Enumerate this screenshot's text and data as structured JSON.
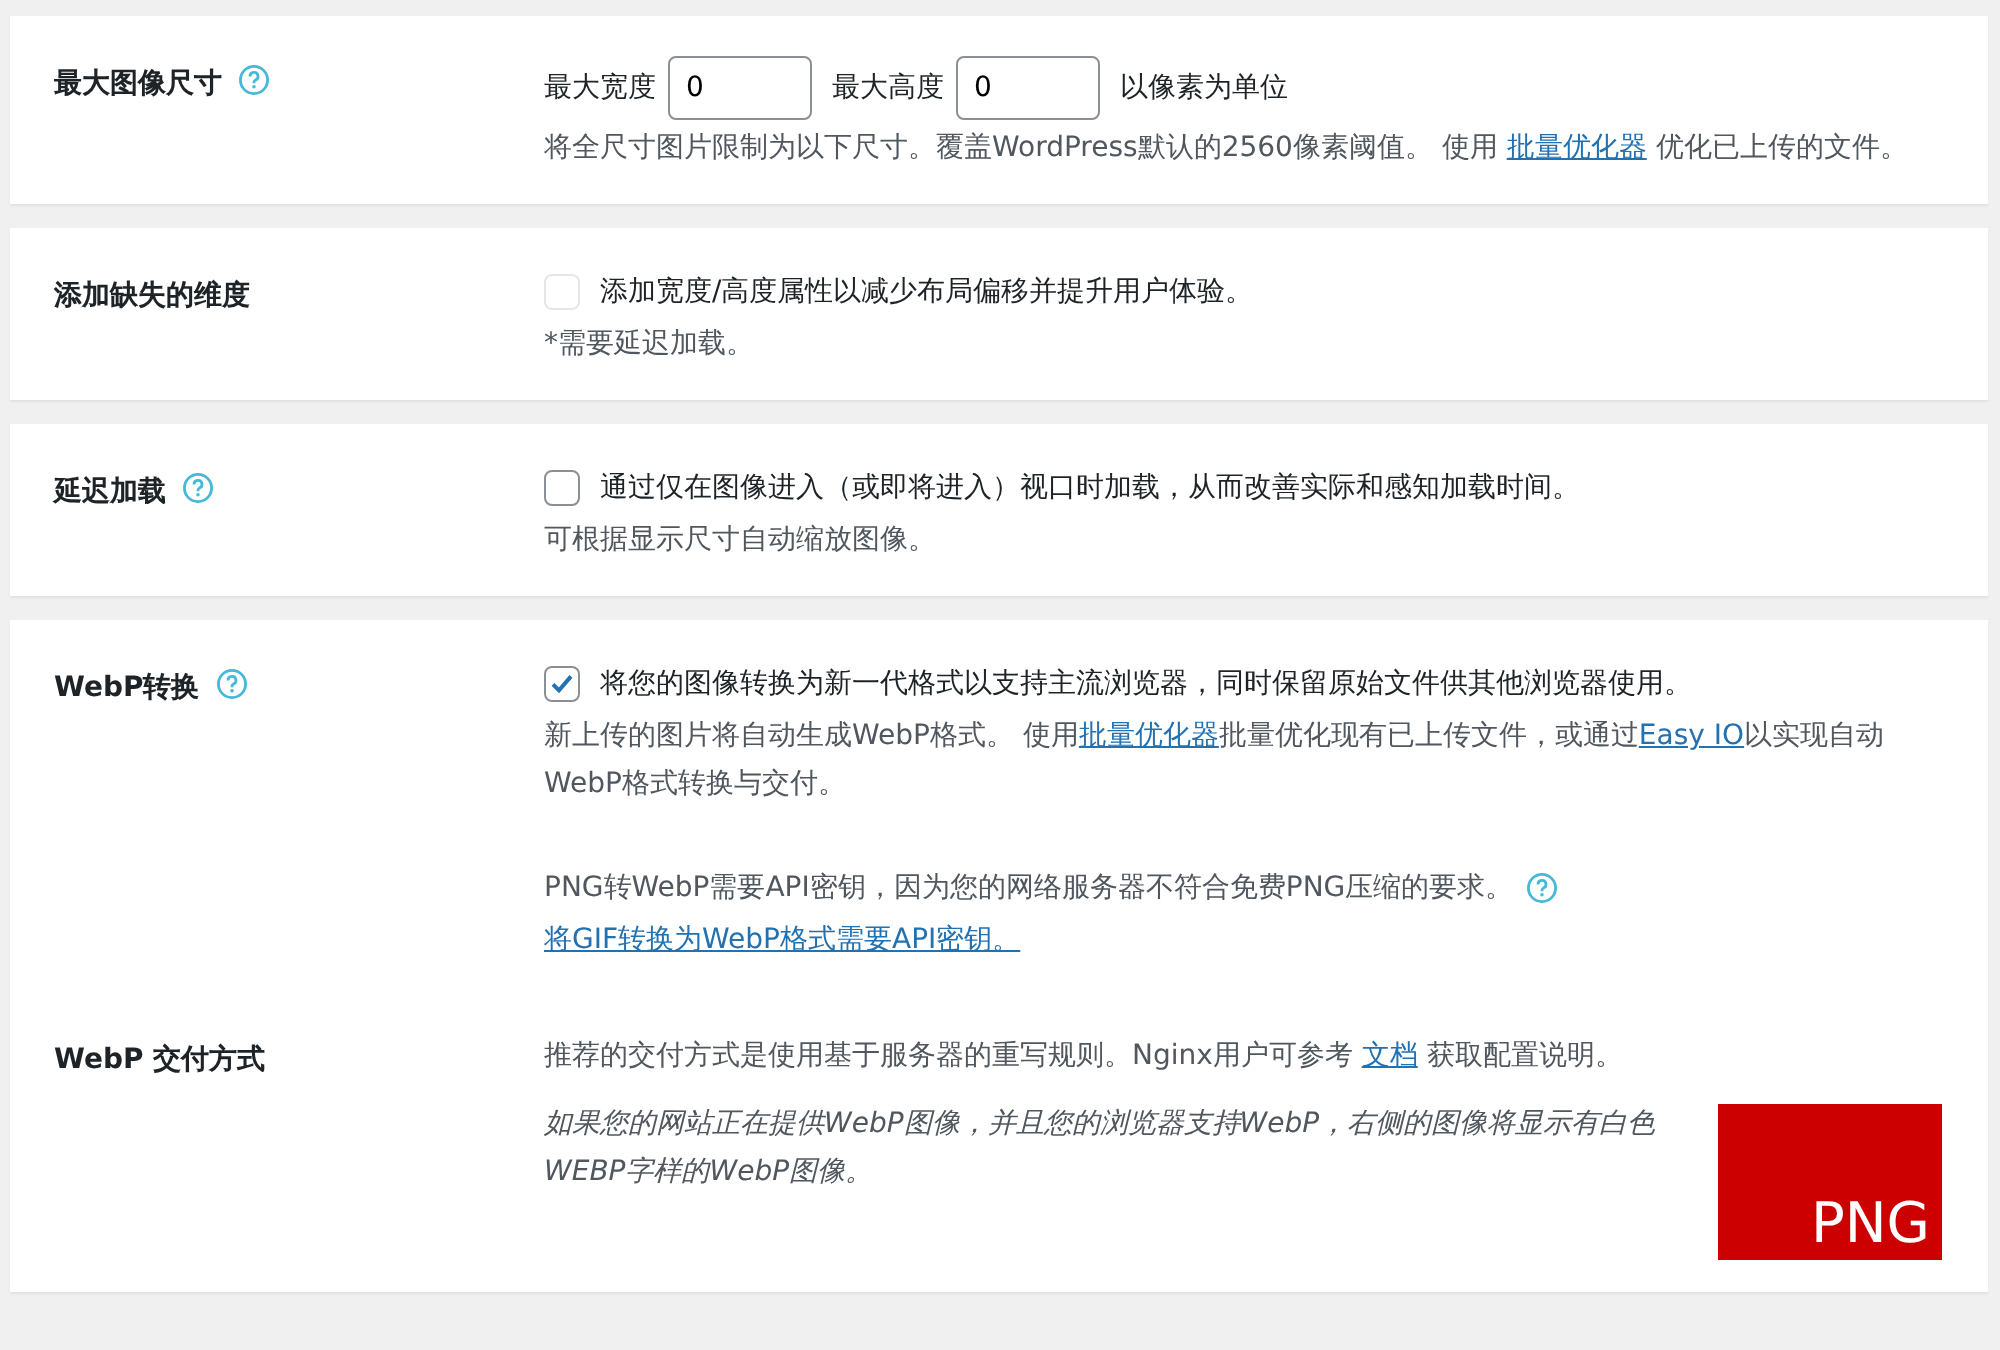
{
  "cards": [
    {
      "rows": [
        {
          "label": "最大图像尺寸",
          "help": true,
          "items": [
            {
              "kind": "size",
              "fields": [
                {
                  "label": "最大宽度",
                  "value": "0"
                },
                {
                  "label": "最大高度",
                  "value": "0"
                }
              ],
              "unit": "以像素为单位"
            },
            {
              "kind": "desc",
              "help": false,
              "parts": [
                {
                  "kind": "text",
                  "text": "将全尺寸图片限制为以下尺寸。覆盖WordPress默认的2560像素阈值。 使用 "
                },
                {
                  "kind": "link",
                  "text": "批量优化器"
                },
                {
                  "kind": "text",
                  "text": " 优化已上传的文件。"
                }
              ]
            }
          ]
        }
      ]
    },
    {
      "rows": [
        {
          "label": "添加缺失的维度",
          "help": false,
          "items": [
            {
              "kind": "checkbox",
              "checked": false,
              "disabled": true,
              "text": "添加宽度/高度属性以减少布局偏移并提升用户体验。"
            },
            {
              "kind": "desc",
              "help": false,
              "parts": [
                {
                  "kind": "text",
                  "text": "*需要延迟加载。"
                }
              ]
            }
          ]
        }
      ]
    },
    {
      "rows": [
        {
          "label": "延迟加载",
          "help": true,
          "items": [
            {
              "kind": "checkbox",
              "checked": false,
              "disabled": false,
              "text": "通过仅在图像进入（或即将进入）视口时加载，从而改善实际和感知加载时间。"
            },
            {
              "kind": "desc",
              "help": false,
              "parts": [
                {
                  "kind": "text",
                  "text": "可根据显示尺寸自动缩放图像。"
                }
              ]
            }
          ]
        }
      ]
    },
    {
      "rows": [
        {
          "label": "WebP转换",
          "help": true,
          "items": [
            {
              "kind": "checkbox",
              "checked": true,
              "disabled": false,
              "text": "将您的图像转换为新一代格式以支持主流浏览器，同时保留原始文件供其他浏览器使用。"
            },
            {
              "kind": "desc",
              "help": false,
              "parts": [
                {
                  "kind": "text",
                  "text": "新上传的图片将自动生成WebP格式。 使用"
                },
                {
                  "kind": "link",
                  "text": "批量优化器"
                },
                {
                  "kind": "text",
                  "text": "批量优化现有已上传文件，或通过"
                },
                {
                  "kind": "link",
                  "text": "Easy IO"
                },
                {
                  "kind": "text",
                  "text": "以实现自动WebP格式转换与交付。"
                }
              ]
            },
            {
              "kind": "gap"
            },
            {
              "kind": "desc",
              "help": true,
              "parts": [
                {
                  "kind": "text",
                  "text": "PNG转WebP需要API密钥，因为您的网络服务器不符合免费PNG压缩的要求。"
                }
              ]
            },
            {
              "kind": "desc",
              "help": false,
              "parts": [
                {
                  "kind": "link",
                  "text": "将GIF转换为WebP格式需要API密钥。"
                }
              ]
            }
          ]
        },
        {
          "label": "WebP 交付方式",
          "help": false,
          "items": [
            {
              "kind": "desc",
              "help": false,
              "parts": [
                {
                  "kind": "text",
                  "text": "推荐的交付方式是使用基于服务器的重写规则。Nginx用户可参考 "
                },
                {
                  "kind": "link",
                  "text": "文档"
                },
                {
                  "kind": "text",
                  "text": " 获取配置说明。"
                }
              ]
            },
            {
              "kind": "note",
              "text": "如果您的网站正在提供WebP图像，并且您的浏览器支持WebP，右侧的图像将显示有白色WEBP字样的WebP图像。",
              "badge": "PNG"
            }
          ]
        }
      ]
    }
  ]
}
